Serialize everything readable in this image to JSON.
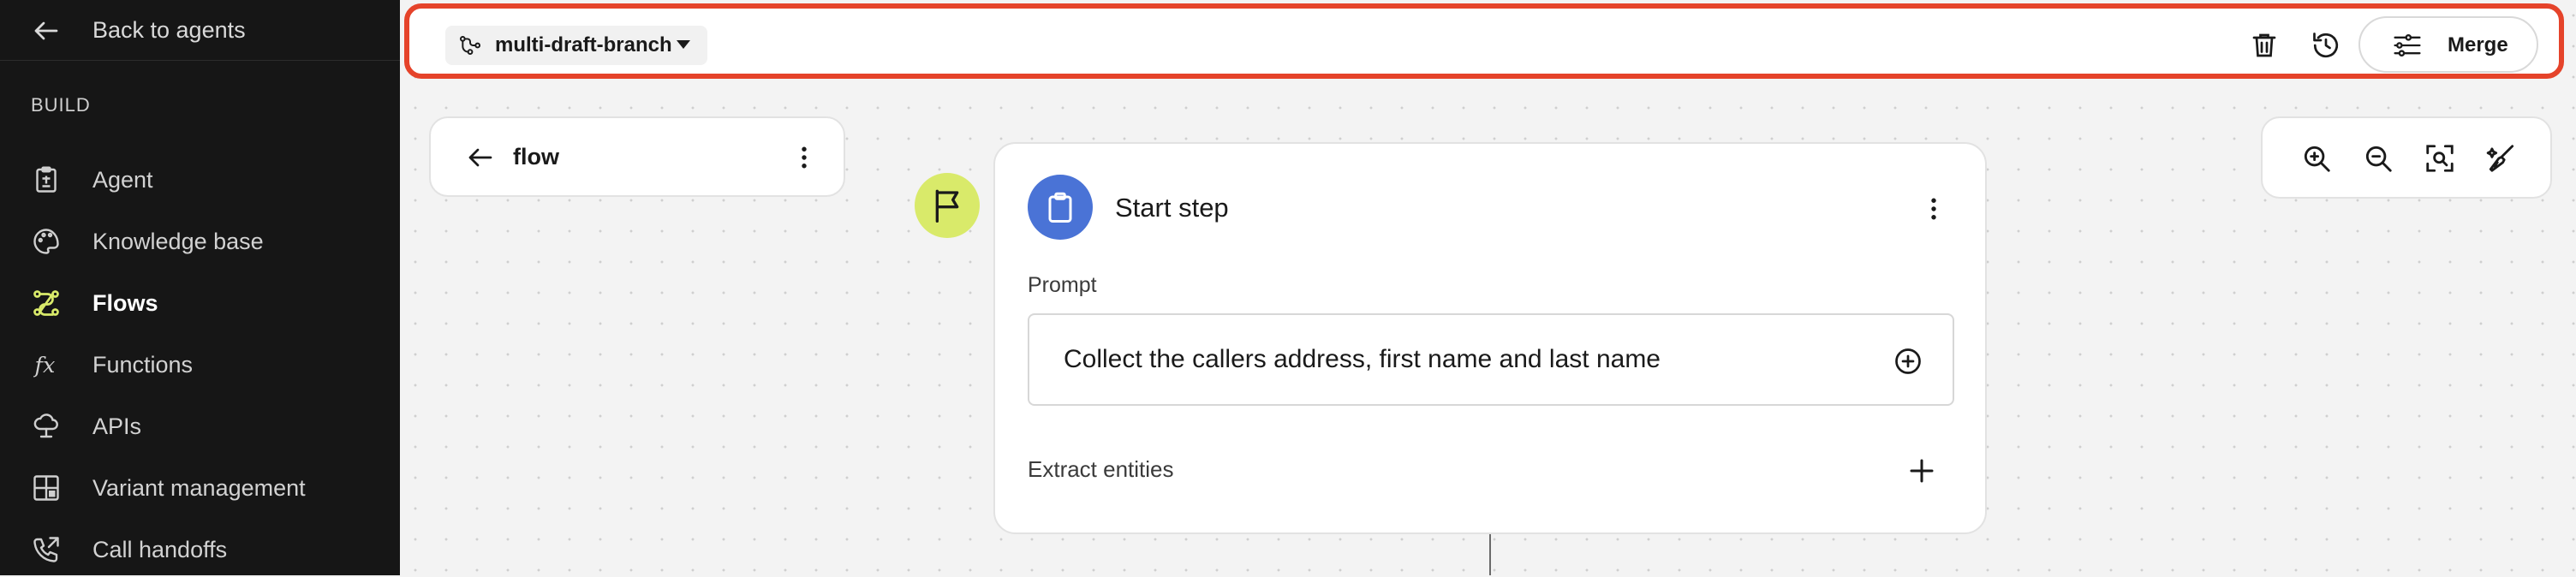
{
  "sidebar": {
    "back_label": "Back to agents",
    "section_label": "BUILD",
    "items": [
      {
        "label": "Agent",
        "icon": "clipboard-icon",
        "active": false
      },
      {
        "label": "Knowledge base",
        "icon": "palette-icon",
        "active": false
      },
      {
        "label": "Flows",
        "icon": "flow-icon",
        "active": true
      },
      {
        "label": "Functions",
        "icon": "function-icon",
        "active": false
      },
      {
        "label": "APIs",
        "icon": "api-icon",
        "active": false
      },
      {
        "label": "Variant management",
        "icon": "grid-icon",
        "active": false
      },
      {
        "label": "Call handoffs",
        "icon": "phone-forward-icon",
        "active": false
      }
    ],
    "active_color": "#d9ea6a"
  },
  "topbar": {
    "branch_name": "multi-draft-branch",
    "merge_label": "Merge",
    "highlight_color": "#e5432a"
  },
  "flow_panel": {
    "title": "flow"
  },
  "start_step": {
    "title": "Start step",
    "prompt_label": "Prompt",
    "prompt_text": "Collect the callers address, first name and last name",
    "extract_label": "Extract entities",
    "avatar_color": "#4a73d6",
    "flag_color": "#d9ea6a"
  }
}
